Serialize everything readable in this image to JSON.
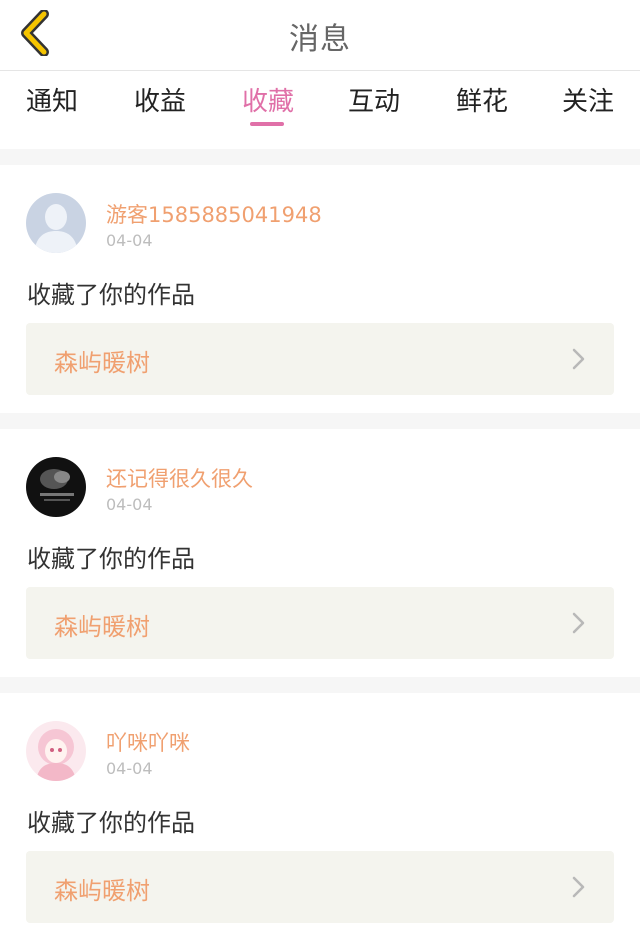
{
  "header": {
    "title": "消息"
  },
  "tabs": [
    {
      "label": "通知",
      "active": false
    },
    {
      "label": "收益",
      "active": false
    },
    {
      "label": "收藏",
      "active": true
    },
    {
      "label": "互动",
      "active": false
    },
    {
      "label": "鲜花",
      "active": false
    },
    {
      "label": "关注",
      "active": false
    }
  ],
  "messages": [
    {
      "username": "游客1585885041948",
      "date": "04-04",
      "action": "收藏了你的作品",
      "work_title": "森屿暖树",
      "avatar": "default-avatar-icon"
    },
    {
      "username": "还记得很久很久",
      "date": "04-04",
      "action": "收藏了你的作品",
      "work_title": "森屿暖树",
      "avatar": "dark-photo-avatar"
    },
    {
      "username": "吖咪吖咪",
      "date": "04-04",
      "action": "收藏了你的作品",
      "work_title": "森屿暖树",
      "avatar": "anime-girl-avatar"
    }
  ],
  "colors": {
    "accent_pink": "#e070a8",
    "accent_orange": "#f0a070",
    "back_icon": "#f5c400"
  },
  "icons": {
    "back": "chevron-left-icon",
    "item_arrow": "chevron-right-icon"
  }
}
